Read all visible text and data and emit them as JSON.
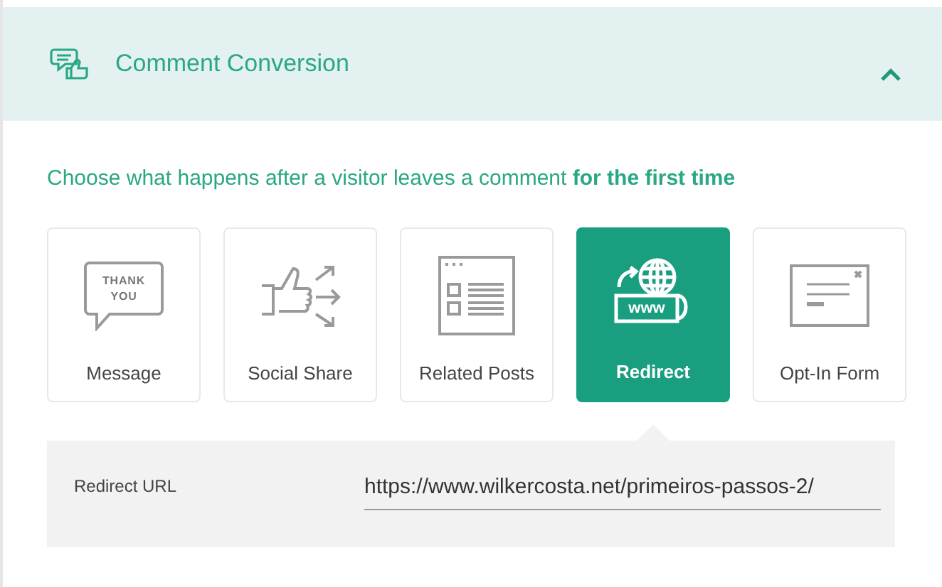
{
  "section": {
    "title": "Comment Conversion",
    "expanded": true
  },
  "prompt": "Choose what happens after a visitor leaves a comment **for the first time**",
  "options": [
    {
      "kind": "message",
      "label": "Message",
      "selected": false,
      "icon_text": [
        "THANK",
        "YOU"
      ]
    },
    {
      "kind": "social",
      "label": "Social Share",
      "selected": false
    },
    {
      "kind": "related",
      "label": "Related Posts",
      "selected": false
    },
    {
      "kind": "redirect",
      "label": "Redirect",
      "selected": true,
      "icon_text": [
        "www"
      ]
    },
    {
      "kind": "optin",
      "label": "Opt-In Form",
      "selected": false
    }
  ],
  "settings": {
    "label": "Redirect URL",
    "value": "https://www.wilkercosta.net/primeiros-passos-2/"
  }
}
